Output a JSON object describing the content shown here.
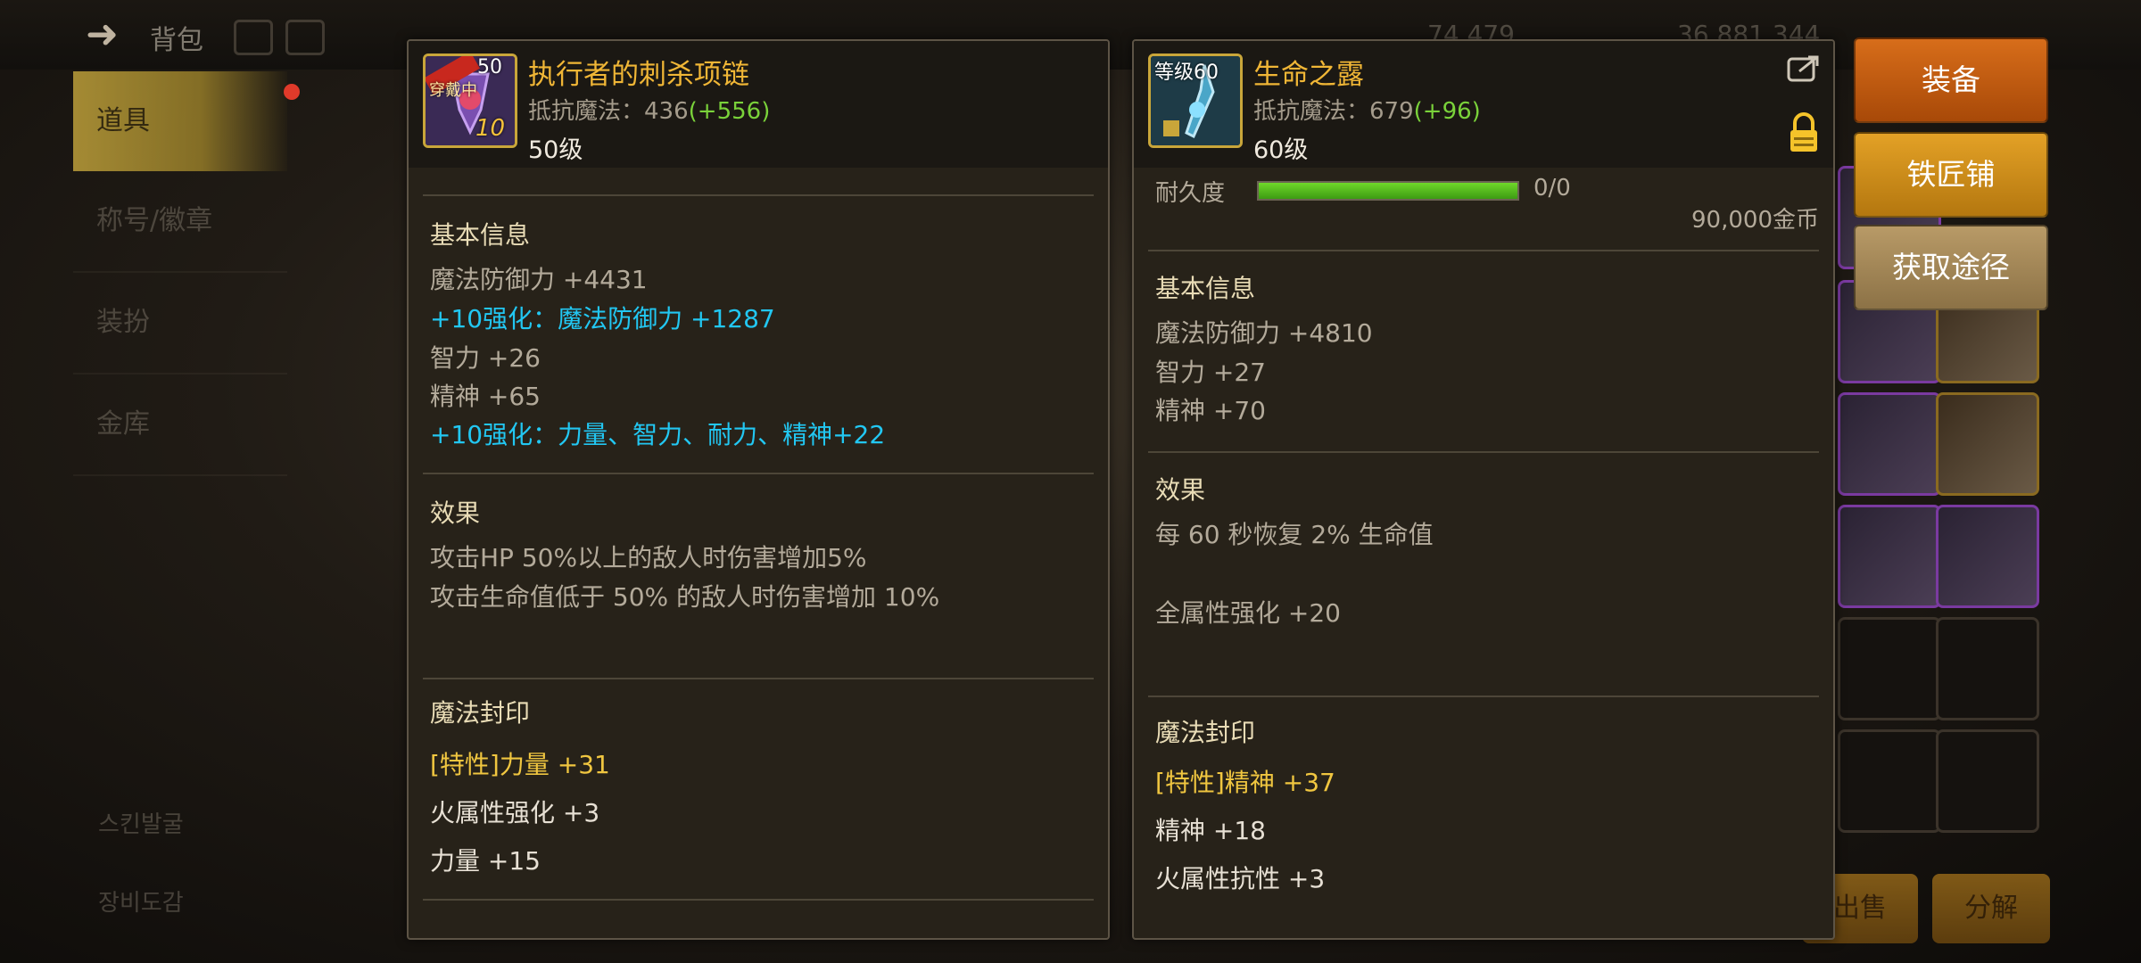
{
  "background": {
    "top_title": "背包",
    "currency_1": "74,479",
    "currency_2": "36,881,344",
    "sidebar": [
      "道具",
      "称号/徽章",
      "装扮",
      "金库"
    ],
    "sidebar_bottom": [
      "스킨발굴",
      "장비도감"
    ],
    "sell_label": "出售",
    "disassemble_label": "分解"
  },
  "left_item": {
    "name": "执行者的刺杀项链",
    "level_badge": "50",
    "equipped_tag": "穿戴中",
    "enhance_badge": "10",
    "resist_label": "抵抗魔法：436",
    "resist_bonus": "(+556)",
    "level": "50级",
    "basic_title": "基本信息",
    "basic_lines": [
      "魔法防御力 +4431",
      "+10强化：魔法防御力 +1287",
      "智力 +26",
      "精神 +65",
      "+10强化：力量、智力、耐力、精神+22"
    ],
    "effect_title": "效果",
    "effect_lines": [
      "攻击HP 50%以上的敌人时伤害增加5%",
      "攻击生命值低于 50% 的敌人时伤害增加 10%"
    ],
    "seal_title": "魔法封印",
    "seal_lines": [
      "[特性]力量 +31",
      "火属性强化 +3",
      "力量 +15"
    ]
  },
  "right_item": {
    "name": "生命之露",
    "level_badge": "等级60",
    "resist_label": "抵抗魔法：679",
    "resist_bonus": "(+96)",
    "level": "60级",
    "durability_label": "耐久度",
    "durability_value": "0/0",
    "durability_fraction": 1.0,
    "price": "90,000金币",
    "basic_title": "基本信息",
    "basic_lines": [
      "魔法防御力 +4810",
      "智力 +27",
      "精神 +70"
    ],
    "effect_title": "效果",
    "effect_lines": [
      "每 60 秒恢复 2% 生命值",
      "全属性强化 +20"
    ],
    "seal_title": "魔法封印",
    "seal_lines": [
      "[特性]精神 +37",
      "精神 +18",
      "火属性抗性 +3"
    ]
  },
  "actions": {
    "equip": "装备",
    "blacksmith": "铁匠铺",
    "acquire": "获取途径"
  },
  "colors": {
    "title_gold": "#f0b636",
    "bonus_green": "#7ad23a",
    "enhance_cyan": "#22c7f2",
    "trait_gold": "#f0c640"
  }
}
